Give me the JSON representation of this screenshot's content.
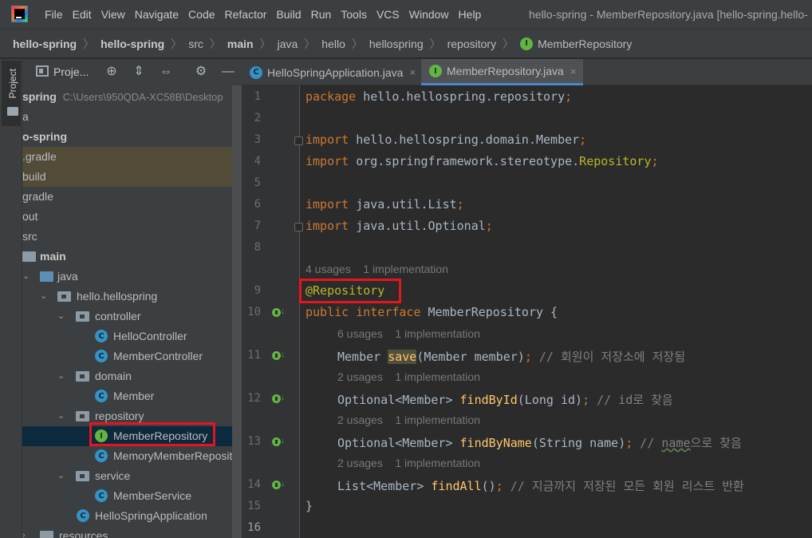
{
  "menubar": {
    "items": [
      "File",
      "Edit",
      "View",
      "Navigate",
      "Code",
      "Refactor",
      "Build",
      "Run",
      "Tools",
      "VCS",
      "Window",
      "Help"
    ],
    "window_title": "hello-spring - MemberRepository.java [hello-spring.hello-"
  },
  "breadcrumb": [
    "hello-spring",
    "hello-spring",
    "src",
    "main",
    "java",
    "hello",
    "hellospring",
    "repository",
    "MemberRepository"
  ],
  "stripe": {
    "project_label": "Project"
  },
  "project_panel": {
    "title": "Proje...",
    "tree": [
      {
        "label": "spring",
        "path": "C:\\Users\\950QDA-XC58B\\Desktop"
      },
      {
        "label": "a"
      },
      {
        "label": "o-spring"
      },
      {
        "label": ".gradle"
      },
      {
        "label": "build"
      },
      {
        "label": "gradle"
      },
      {
        "label": "out"
      },
      {
        "label": "src"
      },
      {
        "label": "main"
      },
      {
        "label": "java"
      },
      {
        "label": "hello.hellospring"
      },
      {
        "label": "controller"
      },
      {
        "label": "HelloController"
      },
      {
        "label": "MemberController"
      },
      {
        "label": "domain"
      },
      {
        "label": "Member"
      },
      {
        "label": "repository"
      },
      {
        "label": "MemberRepository"
      },
      {
        "label": "MemoryMemberRepositor"
      },
      {
        "label": "service"
      },
      {
        "label": "MemberService"
      },
      {
        "label": "HelloSpringApplication"
      },
      {
        "label": "resources"
      }
    ]
  },
  "editor_tabs": [
    {
      "label": "HelloSpringApplication.java",
      "close": "×"
    },
    {
      "label": "MemberRepository.java",
      "close": "×"
    }
  ],
  "editor": {
    "line_numbers": [
      "1",
      "2",
      "3",
      "4",
      "5",
      "6",
      "7",
      "8",
      "9",
      "10",
      "11",
      "12",
      "13",
      "14",
      "15",
      "16"
    ],
    "code": {
      "l1_kw": "package",
      "l1_rest": " hello.hellospring.repository",
      "l1_semi": ";",
      "l3_kw": "import",
      "l3_rest": " hello.hellospring.domain.Member",
      "l3_semi": ";",
      "l4_kw": "import",
      "l4_rest": " org.springframework.stereotype.",
      "l4_ann": "Repository",
      "l4_semi": ";",
      "l6_kw": "import",
      "l6_rest": " java.util.List",
      "l6_semi": ";",
      "l7_kw": "import",
      "l7_rest": " java.util.Optional",
      "l7_semi": ";",
      "hint_interface": "4 usages    1 implementation",
      "l9_ann": "@Repository",
      "l10_kw": "public interface",
      "l10_rest": " MemberRepository {",
      "hint_save": "6 usages    1 implementation",
      "l11_a": "Member ",
      "l11_fn": "save",
      "l11_b": "(Member member)",
      "l11_semi": ";",
      "l11_cm": " // 회원이 저장소에 저장됨",
      "hint_findById": "2 usages    1 implementation",
      "l12_a": "Optional<Member> ",
      "l12_fn": "findById",
      "l12_b": "(Long id)",
      "l12_semi": ";",
      "l12_cm": " // id로 찾음",
      "hint_findByName": "2 usages    1 implementation",
      "l13_a": "Optional<Member> ",
      "l13_fn": "findByName",
      "l13_b": "(String name)",
      "l13_semi": ";",
      "l13_cm1": " // ",
      "l13_cm_name": "name",
      "l13_cm2": "으로 찾음",
      "hint_findAll": "2 usages    1 implementation",
      "l14_a": "List<Member> ",
      "l14_fn": "findAll",
      "l14_b": "()",
      "l14_semi": ";",
      "l14_cm": " // 지금까지 저장된 모든 회원 리스트 반환",
      "l15": "}"
    }
  },
  "colors": {
    "keyword": "#cc7832",
    "annotation": "#bbb529",
    "method": "#ffc66d",
    "comment": "#808080",
    "text": "#a9b7c6",
    "highlight_box": "#e5141e",
    "selected_row": "#0d293e",
    "interface_badge": "#62b543",
    "class_badge": "#3592c4"
  }
}
